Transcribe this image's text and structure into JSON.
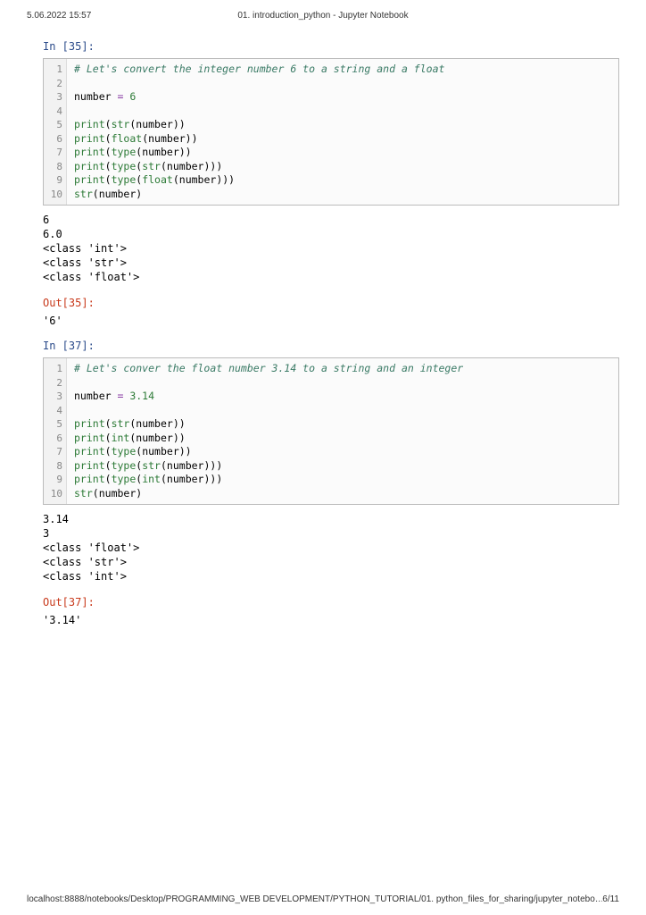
{
  "header": {
    "timestamp": "5.06.2022 15:57",
    "title": "01. introduction_python - Jupyter Notebook"
  },
  "cells": [
    {
      "in_label": "In [35]:",
      "lines": [
        "1",
        "2",
        "3",
        "4",
        "5",
        "6",
        "7",
        "8",
        "9",
        "10"
      ],
      "code": {
        "l1_comment": "# Let's convert the integer number 6 to a string and a float",
        "l3_var": "number",
        "l3_eq": " = ",
        "l3_val": "6",
        "print": "print",
        "str": "str",
        "float": "float",
        "int": "int",
        "type": "type",
        "num": "number"
      },
      "stdout": "6\n6.0\n<class 'int'>\n<class 'str'>\n<class 'float'>",
      "out_label": "Out[35]:",
      "result": "'6'"
    },
    {
      "in_label": "In [37]:",
      "lines": [
        "1",
        "2",
        "3",
        "4",
        "5",
        "6",
        "7",
        "8",
        "9",
        "10"
      ],
      "code": {
        "l1_comment": "# Let's conver the float number 3.14 to a string and an integer",
        "l3_var": "number",
        "l3_eq": " = ",
        "l3_val": "3.14",
        "print": "print",
        "str": "str",
        "float": "float",
        "int": "int",
        "type": "type",
        "num": "number"
      },
      "stdout": "3.14\n3\n<class 'float'>\n<class 'str'>\n<class 'int'>",
      "out_label": "Out[37]:",
      "result": "'3.14'"
    }
  ],
  "footer": {
    "path": "localhost:8888/notebooks/Desktop/PROGRAMMING_WEB DEVELOPMENT/PYTHON_TUTORIAL/01. python_files_for_sharing/jupyter_notebo…",
    "page": "6/11"
  }
}
